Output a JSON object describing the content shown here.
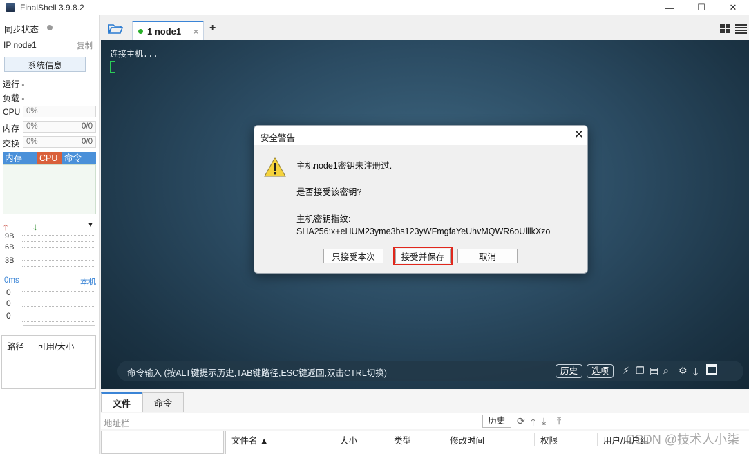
{
  "titlebar": {
    "title": "FinalShell 3.9.8.2",
    "minimize": "—",
    "maximize": "☐",
    "close": "✕"
  },
  "sidebar": {
    "sync_label": "同步状态",
    "ip_label": "IP  node1",
    "copy_label": "复制",
    "sysinfo_button": "系统信息",
    "run_label": "运行 -",
    "load_label": "负载 -",
    "cpu": {
      "label": "CPU",
      "value": "0%"
    },
    "memory": {
      "label": "内存",
      "value": "0%",
      "extra": "0/0"
    },
    "swap": {
      "label": "交换",
      "value": "0%",
      "extra": "0/0"
    },
    "tabs": [
      "内存",
      "CPU",
      "命令"
    ],
    "net_values": [
      "9B",
      "6B",
      "3B"
    ],
    "ping_label": "0ms",
    "ping_target": "本机",
    "ping_values": [
      "0",
      "0",
      "0"
    ],
    "disk_headers": [
      "路径",
      "可用/大小"
    ]
  },
  "session_tab": {
    "label": "1 node1",
    "close": "×",
    "add": "+"
  },
  "terminal": {
    "text": "连接主机..."
  },
  "cmdbar": {
    "hint": "命令输入 (按ALT键提示历史,TAB键路径,ESC键返回,双击CTRL切换)",
    "history_button": "历史",
    "options_button": "选项"
  },
  "bottom": {
    "tabs": [
      "文件",
      "命令"
    ],
    "address_placeholder": "地址栏",
    "history_button": "历史",
    "columns": [
      "文件名 ▲",
      "大小",
      "类型",
      "修改时间",
      "权限",
      "用户/用户组"
    ],
    "watermark": "CSDN @技术人小柒"
  },
  "dialog": {
    "title": "安全警告",
    "close": "✕",
    "line1": "主机node1密钥未注册过.",
    "line2": "是否接受该密钥?",
    "line3": "主机密钥指纹:",
    "fingerprint": "SHA256:x+eHUM23yme3bs123yWFmgfaYeUhvMQWR6oUlllkXzo",
    "buttons": {
      "accept_once": "只接受本次",
      "accept_save": "接受并保存",
      "cancel": "取消"
    }
  },
  "colors": {
    "accent": "#3a84d6",
    "tab_mem": "#4a90d9",
    "tab_cpu": "#d9603b",
    "tab_cmd": "#4a90d9",
    "highlight_border": "#e0271c",
    "status_green": "#27ae27"
  }
}
